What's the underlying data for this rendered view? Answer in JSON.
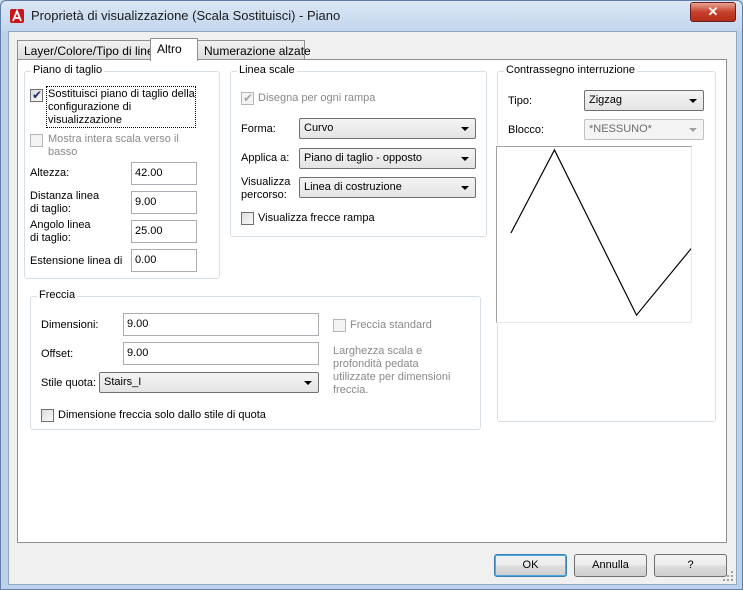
{
  "window": {
    "title": "Proprietà di visualizzazione (Scala Sostituisci) - Piano",
    "close_glyph": "✕"
  },
  "tabs": [
    {
      "label": "Layer/Colore/Tipo di linea",
      "active": false
    },
    {
      "label": "Altro",
      "active": true
    },
    {
      "label": "Numerazione alzate",
      "active": false
    }
  ],
  "piano_taglio": {
    "title": "Piano di taglio",
    "override": {
      "label": "Sostituisci piano di taglio della configurazione di visualizzazione",
      "line1": "Sostituisci piano di taglio della",
      "line2": "configurazione di",
      "line3": "visualizzazione",
      "checked": true
    },
    "show_full": {
      "line1": "Mostra intera scala verso il",
      "line2": "basso",
      "checked": false,
      "enabled": false
    },
    "altezza": {
      "label": "Altezza:",
      "value": "42.00"
    },
    "distanza": {
      "line1": "Distanza linea",
      "line2": "di taglio:",
      "value": "9.00"
    },
    "angolo": {
      "line1": "Angolo linea",
      "line2": "di taglio:",
      "value": "25.00"
    },
    "estensione": {
      "label": "Estensione linea di",
      "value": "0.00"
    }
  },
  "linea_scale": {
    "title": "Linea scale",
    "disegna": {
      "label": "Disegna per ogni rampa",
      "checked": true,
      "enabled": false
    },
    "forma": {
      "label": "Forma:",
      "value": "Curvo"
    },
    "applica": {
      "label": "Applica a:",
      "value": "Piano di taglio - opposto"
    },
    "visualizza": {
      "line1": "Visualizza",
      "line2": "percorso:",
      "value": "Linea di costruzione"
    },
    "frecce": {
      "label": "Visualizza frecce rampa",
      "checked": false
    }
  },
  "freccia": {
    "title": "Freccia",
    "dimensioni": {
      "label": "Dimensioni:",
      "value": "9.00"
    },
    "offset": {
      "label": "Offset:",
      "value": "9.00"
    },
    "stile": {
      "label": "Stile quota:",
      "value": "Stairs_I"
    },
    "standard": {
      "label": "Freccia standard",
      "checked": false,
      "enabled": false
    },
    "note": {
      "line1": "Larghezza scala e",
      "line2": "profondità pedata",
      "line3": "utilizzate per dimensioni",
      "line4": "freccia."
    },
    "solo_stile": {
      "label": "Dimensione freccia solo dallo stile di quota",
      "checked": false
    }
  },
  "contrassegno": {
    "title": "Contrassegno interruzione",
    "tipo": {
      "label": "Tipo:",
      "value": "Zigzag"
    },
    "blocco": {
      "label": "Blocco:",
      "value": "*NESSUNO*"
    }
  },
  "buttons": {
    "ok": "OK",
    "cancel": "Annulla",
    "help": "?"
  },
  "colors": {
    "accent": "#3c7fb1",
    "app_icon": "#c8161d",
    "close": "#c7402b"
  },
  "icons": {
    "app": "autocad-logo-icon",
    "close": "close-icon",
    "check": "checkmark-icon",
    "dropdown": "chevron-down-icon",
    "grip": "resize-grip-icon"
  }
}
